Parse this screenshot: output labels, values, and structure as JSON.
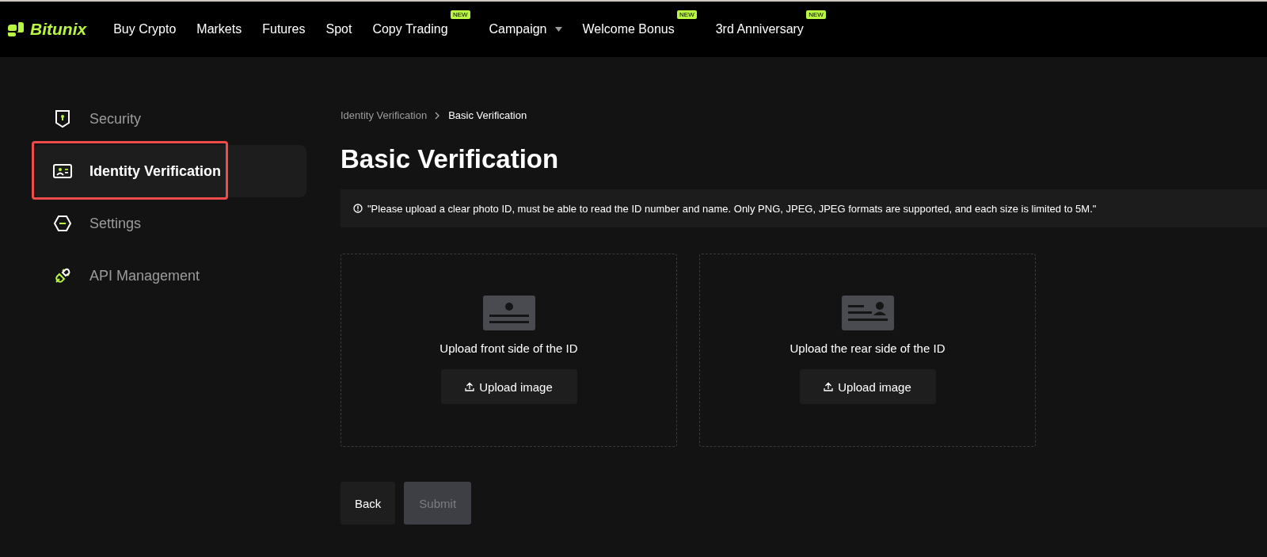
{
  "header": {
    "logo": "Bitunix",
    "nav": [
      {
        "label": "Buy Crypto"
      },
      {
        "label": "Markets"
      },
      {
        "label": "Futures"
      },
      {
        "label": "Spot"
      },
      {
        "label": "Copy Trading",
        "badge": "NEW"
      },
      {
        "label": "Campaign",
        "dropdown": true
      },
      {
        "label": "Welcome Bonus",
        "badge": "NEW"
      },
      {
        "label": "3rd Anniversary",
        "badge": "NEW"
      }
    ]
  },
  "sidebar": {
    "items": [
      {
        "kind": "shield",
        "label": "Security",
        "selected": false,
        "highlighted": false
      },
      {
        "kind": "id-card",
        "label": "Identity Verification",
        "selected": true,
        "highlighted": true
      },
      {
        "kind": "hexagon",
        "label": "Settings",
        "selected": false,
        "highlighted": false
      },
      {
        "kind": "plug",
        "label": "API Management",
        "selected": false,
        "highlighted": false
      }
    ]
  },
  "breadcrumb": [
    "Identity Verification",
    "Basic Verification"
  ],
  "title": "Basic Verification",
  "notice": "\"Please upload a clear photo ID, must be able to read the ID number and name. Only PNG, JPEG, JPEG formats are supported, and each size is limited to 5M.\"",
  "uploads": [
    {
      "kind": "front",
      "label": "Upload front side of the ID",
      "button": "Upload image"
    },
    {
      "kind": "rear",
      "label": "Upload the rear side of the ID",
      "button": "Upload image"
    }
  ],
  "actions": [
    {
      "label": "Back",
      "disabled": false
    },
    {
      "label": "Submit",
      "disabled": true
    }
  ]
}
